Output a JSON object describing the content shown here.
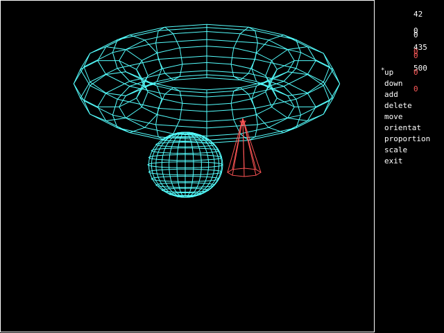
{
  "readouts": {
    "group1": [
      "42",
      "0",
      "435"
    ],
    "group2": [
      "0",
      "0",
      "500"
    ],
    "group3": [
      "0",
      "0",
      "0"
    ],
    "group1_colors": [
      "#ffffff",
      "#ffffff",
      "#ffffff"
    ],
    "group2_colors": [
      "#ffffff",
      "#ff5a5a",
      "#ffffff"
    ],
    "group3_colors": [
      "#ff5a5a",
      "#ff5a5a",
      "#ff5a5a"
    ]
  },
  "menu": {
    "items": [
      {
        "label": "up",
        "id": "up"
      },
      {
        "label": "down",
        "id": "down"
      },
      {
        "label": "add",
        "id": "add"
      },
      {
        "label": "delete",
        "id": "delete"
      },
      {
        "label": "move",
        "id": "move"
      },
      {
        "label": "orientat",
        "id": "orientat"
      },
      {
        "label": "proportion",
        "id": "proportion"
      },
      {
        "label": "scale",
        "id": "scale"
      },
      {
        "label": "exit",
        "id": "exit"
      }
    ],
    "cursor_glyph": "*"
  },
  "scene": {
    "objects": [
      {
        "kind": "torus",
        "name": "torus",
        "color": "#55ffff"
      },
      {
        "kind": "sphere",
        "name": "sphere",
        "color": "#55ffff"
      },
      {
        "kind": "cone",
        "name": "cone",
        "color": "#ff5555"
      }
    ]
  },
  "colors": {
    "background": "#000000",
    "text": "#ffffff",
    "accent_red": "#ff5a5a",
    "wire_cyan": "#55ffff",
    "wire_red": "#ff5555"
  }
}
